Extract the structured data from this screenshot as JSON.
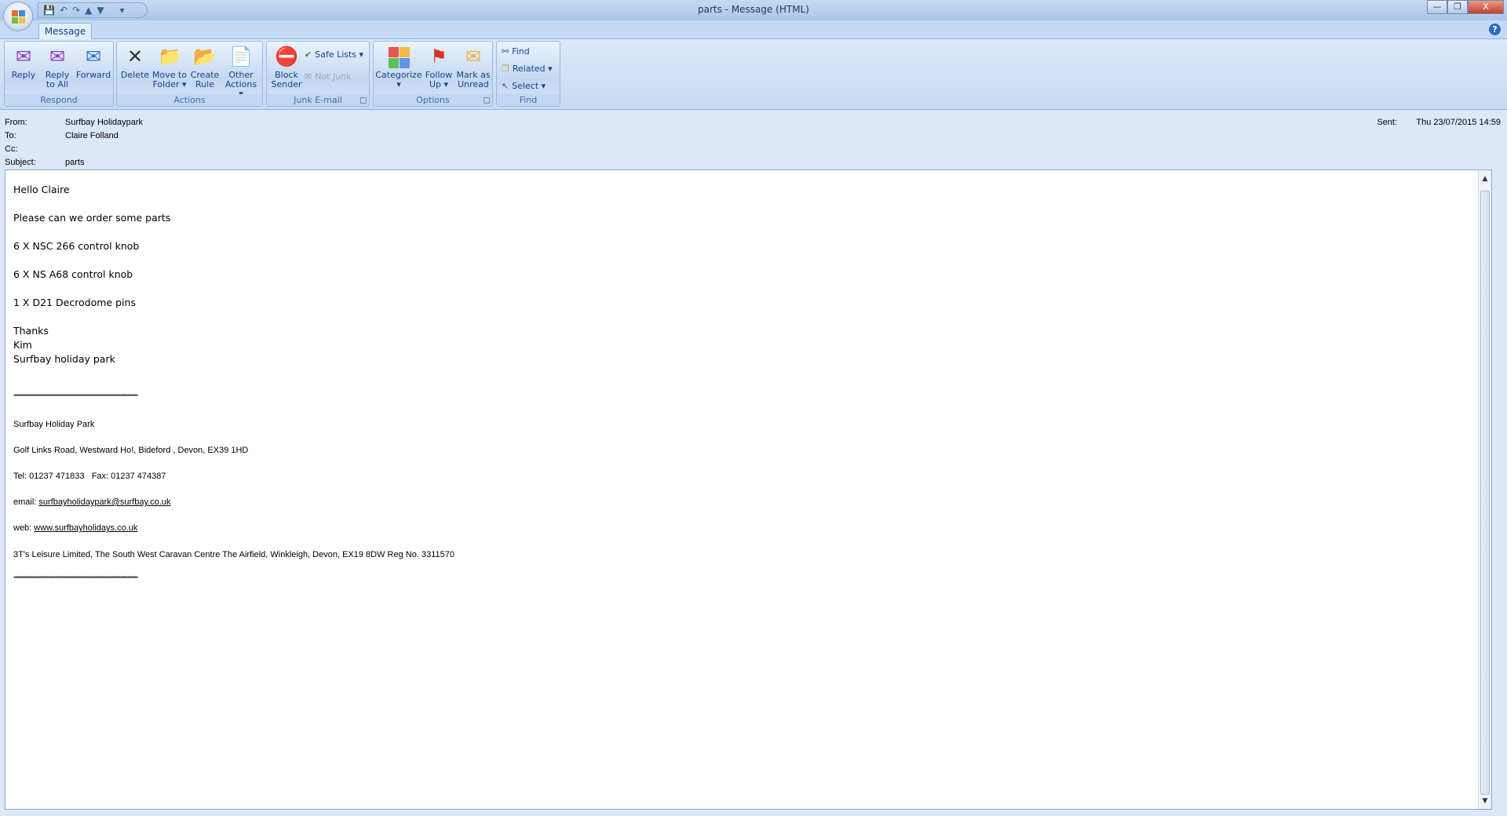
{
  "window": {
    "title": "parts - Message (HTML)",
    "minimize": "—",
    "restore": "❐",
    "close": "X"
  },
  "quick_access": {
    "save": "💾",
    "undo": "↶",
    "redo": "↷",
    "prev": "▲",
    "next": "▼",
    "customize": "▾"
  },
  "tabs": [
    {
      "label": "Message",
      "active": true
    }
  ],
  "help": "?",
  "ribbon": {
    "respond": {
      "label": "Respond",
      "reply": "Reply",
      "reply_all_1": "Reply",
      "reply_all_2": "to All",
      "forward": "Forward"
    },
    "actions": {
      "label": "Actions",
      "delete": "Delete",
      "move_1": "Move to",
      "move_2": "Folder ▾",
      "rule_1": "Create",
      "rule_2": "Rule",
      "other_1": "Other",
      "other_2": "Actions ▾"
    },
    "junk": {
      "label": "Junk E-mail",
      "block_1": "Block",
      "block_2": "Sender",
      "safe_lists": "Safe Lists ▾",
      "not_junk": "Not Junk"
    },
    "options": {
      "label": "Options",
      "categorize": "Categorize",
      "categorize_2": "▾",
      "follow_1": "Follow",
      "follow_2": "Up ▾",
      "mark_1": "Mark as",
      "mark_2": "Unread"
    },
    "find": {
      "label": "Find",
      "find": "Find",
      "related": "Related ▾",
      "select": "Select ▾"
    }
  },
  "header": {
    "from_label": "From:",
    "from": "Surfbay Holidaypark",
    "to_label": "To:",
    "to": "Claire Folland",
    "cc_label": "Cc:",
    "subject_label": "Subject:",
    "subject": "parts",
    "sent_label": "Sent:",
    "sent": "Thu 23/07/2015 14:59"
  },
  "message": {
    "greeting": "Hello Claire",
    "request": "Please can we order some parts",
    "items": [
      "6 X NSC 266 control knob",
      "6 X NS A68 control knob",
      "1 X D21 Decrodome pins"
    ],
    "closing": [
      "Thanks",
      "Kim",
      "Surfbay holiday park"
    ]
  },
  "signature": {
    "divider": "***************************************************************************************",
    "name": "Surfbay Holiday Park",
    "address": "Golf Links Road, Westward Ho!, Bideford , Devon, EX39 1HD",
    "phone": "Tel: 01237 471833   Fax: 01237 474387",
    "email_label": "email: ",
    "email": "surfbayholidaypark@surfbay.co.uk",
    "web_label": "web: ",
    "web": "www.surfbayholidays.co.uk",
    "company": "3T's Leisure Limited, The South West Caravan Centre The Airfield, Winkleigh, Devon, EX19 8DW Reg No. 3311570"
  }
}
